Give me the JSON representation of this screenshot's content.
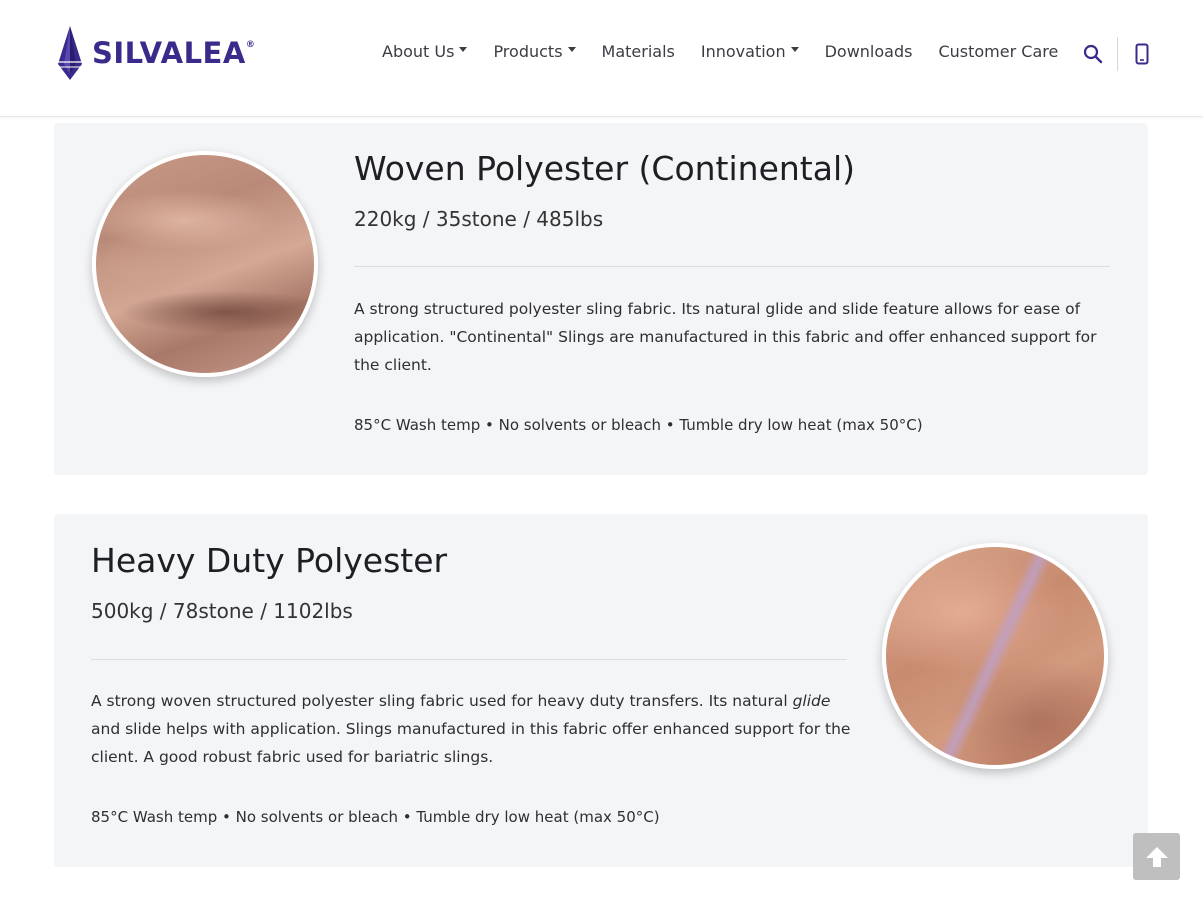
{
  "header": {
    "logo_text": "SILVALEA",
    "logo_mark": "®",
    "nav": [
      {
        "label": "About Us",
        "dropdown": true
      },
      {
        "label": "Products",
        "dropdown": true
      },
      {
        "label": "Materials",
        "dropdown": false
      },
      {
        "label": "Innovation",
        "dropdown": true
      },
      {
        "label": "Downloads",
        "dropdown": false
      },
      {
        "label": "Customer Care",
        "dropdown": false
      }
    ],
    "icons": [
      "search-icon",
      "phone-icon"
    ]
  },
  "materials": [
    {
      "title": "Woven Polyester (Continental)",
      "capacity": "220kg / 35stone / 485lbs",
      "description": "A strong structured polyester sling fabric. Its natural glide and slide feature allows for ease of application. \"Continental\" Slings are manufactured in this fabric and offer enhanced support for the client.",
      "care": "85°C Wash temp • No solvents or bleach • Tumble dry low heat (max 50°C)"
    },
    {
      "title": "Heavy Duty Polyester",
      "capacity": "500kg / 78stone / 1102lbs",
      "description_before": "A strong woven structured polyester sling fabric used for heavy duty transfers. Its natural ",
      "description_em": "glide",
      "description_after": " and slide helps with application. Slings manufactured in this fabric offer enhanced support for the client. A good robust fabric used for bariatric slings.",
      "care": "85°C Wash temp • No solvents or bleach • Tumble dry low heat (max 50°C)"
    }
  ],
  "colors": {
    "brand": "#3b2a8c",
    "card_bg": "#f4f5f7",
    "back_to_top": "#bfbfbf"
  },
  "back_to_top_icon": "arrow-up-icon"
}
